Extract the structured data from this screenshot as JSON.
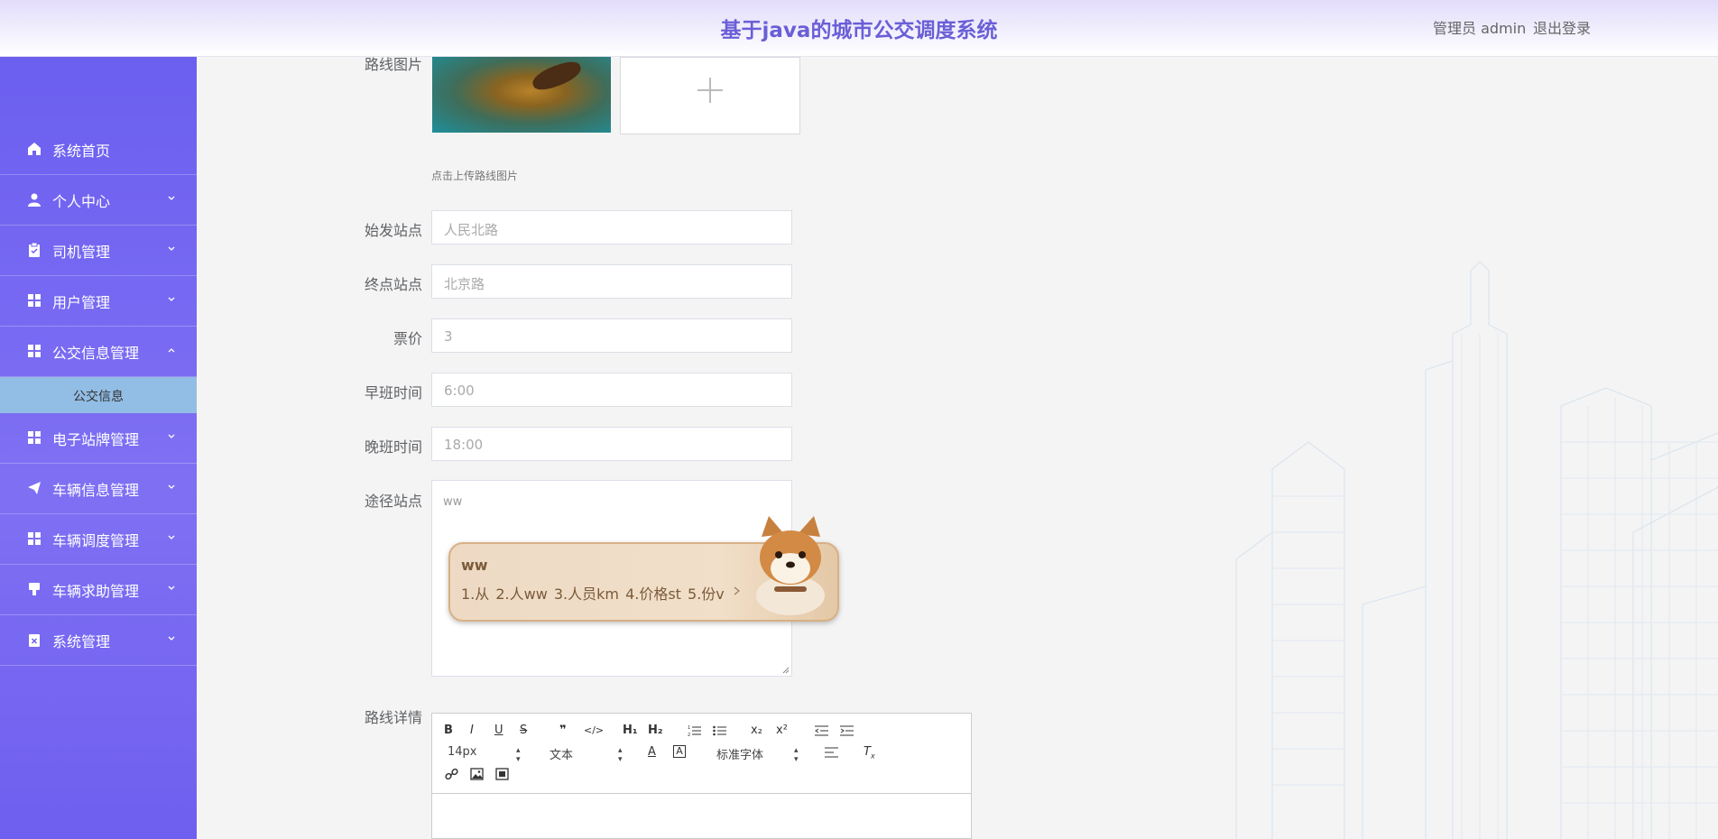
{
  "header": {
    "title": "基于java的城市公交调度系统",
    "user": "管理员 admin",
    "logout": "退出登录"
  },
  "sidebar": {
    "items": [
      {
        "label": "系统首页",
        "icon": "home-icon"
      },
      {
        "label": "个人中心",
        "icon": "user-icon"
      },
      {
        "label": "司机管理",
        "icon": "clipboard-icon"
      },
      {
        "label": "用户管理",
        "icon": "grid-icon"
      },
      {
        "label": "公交信息管理",
        "icon": "grid-icon",
        "expanded": true
      },
      {
        "label": "电子站牌管理",
        "icon": "grid-icon"
      },
      {
        "label": "车辆信息管理",
        "icon": "send-icon"
      },
      {
        "label": "车辆调度管理",
        "icon": "grid-icon"
      },
      {
        "label": "车辆求助管理",
        "icon": "brush-icon"
      },
      {
        "label": "系统管理",
        "icon": "clipboard-x-icon"
      }
    ],
    "subitem": "公交信息",
    "colors": {
      "bg": "#6b5ff0",
      "submenu_bg": "#92bde4"
    }
  },
  "form": {
    "route_image_label": "路线图片",
    "upload_hint": "点击上传路线图片",
    "start_label": "始发站点",
    "start_value": "人民北路",
    "end_label": "终点站点",
    "end_value": "北京路",
    "price_label": "票价",
    "price_value": "3",
    "morning_label": "早班时间",
    "morning_value": "6:00",
    "evening_label": "晚班时间",
    "evening_value": "18:00",
    "via_label": "途径站点",
    "via_value": "ww",
    "detail_label": "路线详情"
  },
  "ime": {
    "composition": "ww",
    "candidates": "1.从  2.人ww  3.人员km  4.价格st  5.份v"
  },
  "editor": {
    "font_size": "14px",
    "paragraph": "文本",
    "font_family": "标准字体"
  }
}
